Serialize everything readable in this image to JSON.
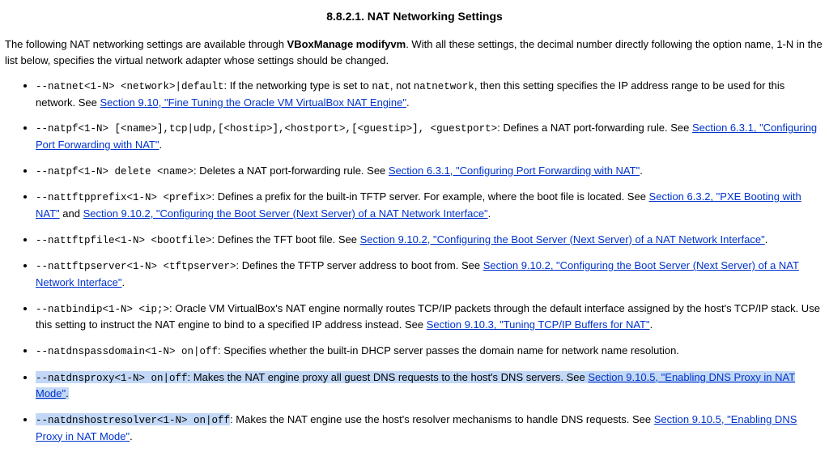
{
  "heading": "8.8.2.1. NAT Networking Settings",
  "intro_pre": "The following NAT networking settings are available through ",
  "intro_bold": "VBoxManage modifyvm",
  "intro_post": ". With all these settings, the decimal number directly following the option name, 1-N in the list below, specifies the virtual network adapter whose settings should be changed.",
  "items": {
    "i0": {
      "cmd": "--natnet<1-N> <network>|default",
      "t0": ": If the networking type is set to ",
      "c1": "nat",
      "t1": ", not ",
      "c2": "natnetwork",
      "t2": ", then this setting specifies the IP address range to be used for this network. See ",
      "link": "Section 9.10, \"Fine Tuning the Oracle VM VirtualBox NAT Engine\"",
      "tail": "."
    },
    "i1": {
      "cmd": "--natpf<1-N> [<name>],tcp|udp,[<hostip>],<hostport>,[<guestip>], <guestport>",
      "t0": ": Defines a NAT port-forwarding rule. See ",
      "link": "Section 6.3.1, \"Configuring Port Forwarding with NAT\"",
      "tail": "."
    },
    "i2": {
      "cmd": "--natpf<1-N> delete <name>",
      "t0": ": Deletes a NAT port-forwarding rule. See ",
      "link": "Section 6.3.1, \"Configuring Port Forwarding with NAT\"",
      "tail": "."
    },
    "i3": {
      "cmd": "--nattftpprefix<1-N> <prefix>",
      "t0": ": Defines a prefix for the built-in TFTP server. For example, where the boot file is located. See ",
      "link1": "Section 6.3.2, \"PXE Booting with NAT\"",
      "mid": " and ",
      "link2": "Section 9.10.2, \"Configuring the Boot Server (Next Server) of a NAT Network Interface\"",
      "tail": "."
    },
    "i4": {
      "cmd": "--nattftpfile<1-N> <bootfile>",
      "t0": ": Defines the TFT boot file. See ",
      "link": "Section 9.10.2, \"Configuring the Boot Server (Next Server) of a NAT Network Interface\"",
      "tail": "."
    },
    "i5": {
      "cmd": "--nattftpserver<1-N> <tftpserver>",
      "t0": ": Defines the TFTP server address to boot from. See ",
      "link": "Section 9.10.2, \"Configuring the Boot Server (Next Server) of a NAT Network Interface\"",
      "tail": "."
    },
    "i6": {
      "cmd": "--natbindip<1-N> <ip;>",
      "t0": ": Oracle VM VirtualBox's NAT engine normally routes TCP/IP packets through the default interface assigned by the host's TCP/IP stack. Use this setting to instruct the NAT engine to bind to a specified IP address instead. See ",
      "link": "Section 9.10.3, \"Tuning TCP/IP Buffers for NAT\"",
      "tail": "."
    },
    "i7": {
      "cmd": "--natdnspassdomain<1-N> on|off",
      "t0": ": Specifies whether the built-in DHCP server passes the domain name for network name resolution."
    },
    "i8": {
      "cmd": "--natdnsproxy<1-N> on|off",
      "t0": ": Makes the NAT engine proxy all guest DNS requests to the host's DNS servers. See ",
      "link": "Section 9.10.5, \"Enabling DNS Proxy in NAT Mode\"",
      "tail": "."
    },
    "i9": {
      "cmd": "--natdnshostresolver<1-N> on|off",
      "t0": ": Makes the NAT engine use the host's resolver mechanisms to handle DNS requests. See ",
      "link": "Section 9.10.5, \"Enabling DNS Proxy in NAT Mode\"",
      "tail": "."
    }
  }
}
